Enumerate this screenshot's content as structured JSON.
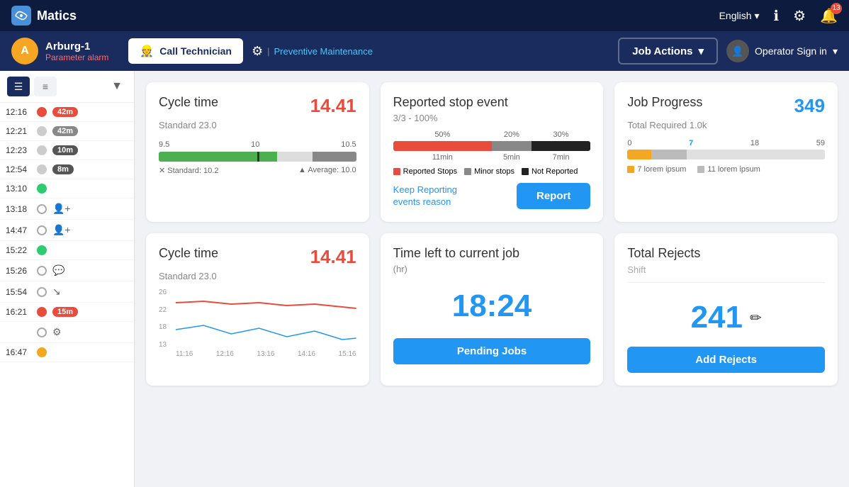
{
  "topNav": {
    "appName": "Matics",
    "language": "English",
    "langDropdown": "▾",
    "notificationCount": "13"
  },
  "toolbar": {
    "machineInitial": "A",
    "machineName": "Arburg-1",
    "machineStatus": "Parameter alarm",
    "callTechLabel": "Call Technician",
    "maintIcon": "≋",
    "maintLabel": "Preventive Maintenance",
    "jobActionsLabel": "Job Actions",
    "operatorLabel": "Operator Sign in",
    "dropdownArrow": "▾"
  },
  "sidebar": {
    "filterIcon": "▼",
    "items": [
      {
        "time": "12:16",
        "dotType": "red",
        "badge": "42m",
        "badgeType": "red"
      },
      {
        "time": "12:21",
        "dotType": "gray",
        "badge": "42m",
        "badgeType": "gray"
      },
      {
        "time": "12:23",
        "dotType": "gray",
        "badge": "10m",
        "badgeType": "dark-gray"
      },
      {
        "time": "12:54",
        "dotType": "gray",
        "badge": "8m",
        "badgeType": "dark-gray"
      },
      {
        "time": "13:10",
        "dotType": "green",
        "icon": ""
      },
      {
        "time": "13:18",
        "dotType": "outline",
        "icon": "👤"
      },
      {
        "time": "14:47",
        "dotType": "outline",
        "icon": "👤"
      },
      {
        "time": "15:22",
        "dotType": "green",
        "icon": ""
      },
      {
        "time": "15:26",
        "dotType": "outline",
        "icon": "💬"
      },
      {
        "time": "15:54",
        "dotType": "outline",
        "icon": "↘"
      },
      {
        "time": "16:21",
        "dotType": "red",
        "badge": "15m",
        "badgeType": "red"
      },
      {
        "time": "",
        "dotType": "outline",
        "icon": "⚙"
      },
      {
        "time": "16:47",
        "dotType": "yellow",
        "icon": ""
      }
    ]
  },
  "cycleTime1": {
    "title": "Cycle time",
    "value": "14.41",
    "subtitle": "Standard 23.0",
    "scaleMin": "9.5",
    "scaleMid": "10",
    "scaleMax": "10.5",
    "standardLabel": "Standard: 10.2",
    "averageLabel": "Average: 10.0"
  },
  "reportedStop": {
    "title": "Reported stop event",
    "subtitle": "3/3 - 100%",
    "bar": [
      {
        "label": "50%",
        "pct": 50,
        "color": "#e74c3c",
        "time": "11min"
      },
      {
        "label": "20%",
        "pct": 20,
        "color": "#888",
        "time": "5min"
      },
      {
        "label": "30%",
        "pct": 30,
        "color": "#222",
        "time": "7min"
      }
    ],
    "legends": [
      {
        "label": "Reported Stops",
        "color": "#e74c3c"
      },
      {
        "label": "Minor stops",
        "color": "#888"
      },
      {
        "label": "Not Reported",
        "color": "#222"
      }
    ],
    "keepReporting": "Keep Reporting events reason",
    "reportBtn": "Report"
  },
  "jobProgress": {
    "title": "Job Progress",
    "value": "349",
    "subtitle": "Total Required 1.0k",
    "scaleValues": [
      "0",
      "7",
      "18",
      "59"
    ],
    "bars": [
      {
        "pct": 12,
        "color": "#f5a623"
      },
      {
        "pct": 18,
        "color": "#bbb"
      },
      {
        "pct": 70,
        "color": "#e8e8e8"
      }
    ],
    "legends": [
      {
        "label": "7 lorem ipsum",
        "color": "#f5a623"
      },
      {
        "label": "11 lorem ipsum",
        "color": "#bbb"
      }
    ]
  },
  "cycleTime2": {
    "title": "Cycle time",
    "value": "14.41",
    "subtitle": "Standard 23.0",
    "yLabels": [
      "26",
      "22",
      "18",
      "13"
    ],
    "xLabels": [
      "11:16",
      "12:16",
      "13:16",
      "14:16",
      "15:16"
    ]
  },
  "timeLeft": {
    "title": "Time left to current job",
    "subtitle": "(hr)",
    "value": "18:24",
    "pendingBtn": "Pending Jobs"
  },
  "totalRejects": {
    "title": "Total Rejects",
    "shiftLabel": "Shift",
    "value": "241",
    "addBtn": "Add Rejects"
  }
}
